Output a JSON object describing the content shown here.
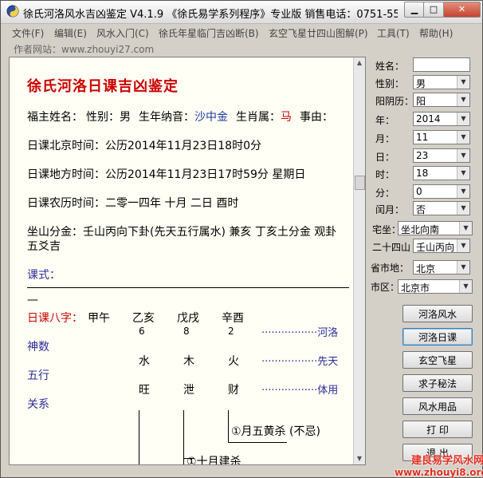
{
  "window": {
    "title": "徐氏河洛风水吉凶鉴定 V4.1.9  《徐氏易学系列程序》专业版   销售电话：0751-55..."
  },
  "menu": [
    "文件(F)",
    "编辑(E)",
    "风水入门(C)",
    "徐氏年星临门吉凶断(B)",
    "玄空飞星廿四山图解(P)",
    "工具(T)",
    "帮助(H)"
  ],
  "website": "作者网站：www.zhouyi27.com",
  "doc": {
    "title": "徐氏河洛日课吉凶鉴定",
    "fuzhu": {
      "label": "福主姓名：",
      "gender_label": "性别：",
      "gender": "男",
      "nayin_label": "生年纳音：",
      "nayin": "沙中金",
      "zodiac_label": "生肖属：",
      "zodiac": "马",
      "matter_label": "事由："
    },
    "beijing_time": "日课北京时间：公历2014年11月23日18时0分",
    "local_time": "日课地方时间：公历2014年11月23日17时59分  星期日",
    "lunar_time": "日课农历时间：二零一四年  十月  二日  酉时",
    "mountain": "坐山分金：壬山丙向下卦(先天五行属水)  兼亥    丁亥土分金  观卦",
    "mountain2": "五爻吉",
    "keshi_label": "课式：",
    "dash_tail": "—",
    "bazi_label": "日课八字：",
    "pillars": [
      "甲午",
      "乙亥",
      "戊戌",
      "辛酉"
    ],
    "numbers": [
      "6",
      "8",
      "2"
    ],
    "shenshu": "神数",
    "wuxing": "五行",
    "guanxi": "关系",
    "elements": [
      "水",
      "木",
      "火"
    ],
    "states": [
      "旺",
      "泄",
      "财"
    ],
    "dots1": "·················河洛",
    "dots2": "·················先天",
    "dots3": "·················体用",
    "note1": "①月五黄杀 (不忌)",
    "note2": "①十月建杀"
  },
  "form": {
    "name_label": "姓名：",
    "name_value": "",
    "gender_label": "性别：",
    "gender": "男",
    "yinyang_label": "阳阴历：",
    "yinyang": "阳",
    "year_label": "年：",
    "year": "2014",
    "month_label": "月：",
    "month": "11",
    "day_label": "日：",
    "day": "23",
    "hour_label": "时：",
    "hour": "18",
    "minute_label": "分：",
    "minute": "0",
    "leap_label": "闰月：",
    "leap": "否",
    "zhaizuo_label": "宅坐：",
    "zhaizuo": "坐北向南",
    "ershisi_label": "二十四山",
    "ershisi": "壬山丙向",
    "province_label": "省市地：",
    "province": "北京",
    "district_label": "市区：",
    "district": "北京市"
  },
  "buttons": [
    "河洛风水",
    "河洛日课",
    "玄空飞星",
    "求子秘法",
    "风水用品",
    "打  印",
    "退  出"
  ],
  "watermark": {
    "line1": "建良易学风水网",
    "line2": "www.zhouyi8.org"
  }
}
